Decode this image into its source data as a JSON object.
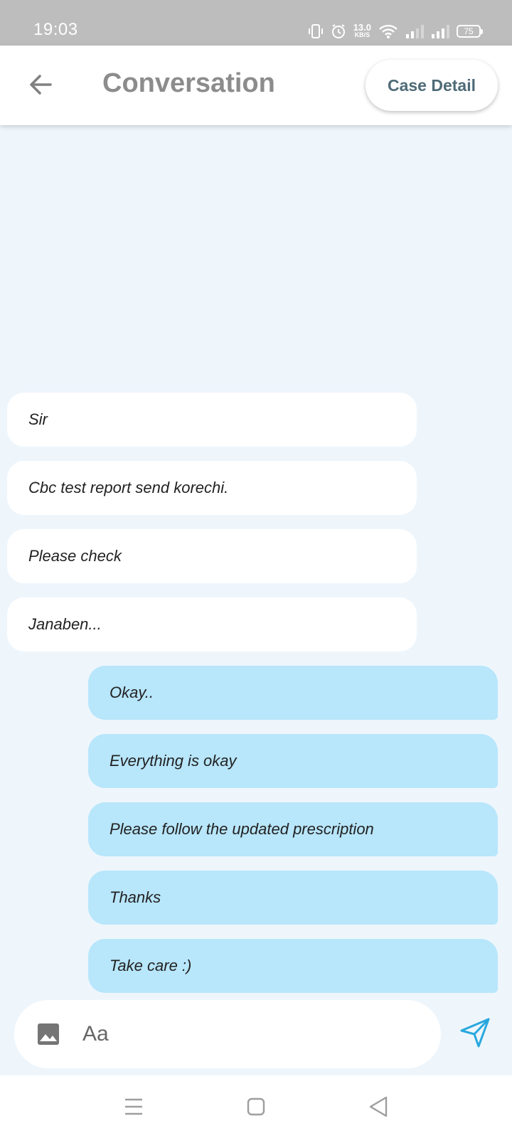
{
  "status_bar": {
    "time": "19:03",
    "net_speed_value": "13.0",
    "net_speed_unit": "KB/S",
    "battery": "75"
  },
  "header": {
    "title": "Conversation",
    "case_detail_label": "Case Detail"
  },
  "messages": [
    {
      "text": "Sir",
      "direction": "incoming"
    },
    {
      "text": "Cbc test report send korechi.",
      "direction": "incoming"
    },
    {
      "text": "Please check",
      "direction": "incoming"
    },
    {
      "text": "Janaben...",
      "direction": "incoming"
    },
    {
      "text": "Okay..",
      "direction": "outgoing"
    },
    {
      "text": "Everything is okay",
      "direction": "outgoing"
    },
    {
      "text": "Please follow the updated prescription",
      "direction": "outgoing"
    },
    {
      "text": "Thanks",
      "direction": "outgoing"
    },
    {
      "text": "Take care :)",
      "direction": "outgoing"
    }
  ],
  "composer": {
    "placeholder": "Aa",
    "value": ""
  },
  "icons": {
    "back": "arrow-left-icon",
    "attach": "image-icon",
    "send": "send-icon",
    "nav_menu": "menu-icon",
    "nav_home": "home-square-icon",
    "nav_back": "back-triangle-icon"
  },
  "colors": {
    "chat_background": "#eef6fc",
    "incoming_bubble": "#ffffff",
    "outgoing_bubble": "#b8e6fb",
    "send_accent": "#29a8dd",
    "case_detail_text": "#4f6b78"
  }
}
